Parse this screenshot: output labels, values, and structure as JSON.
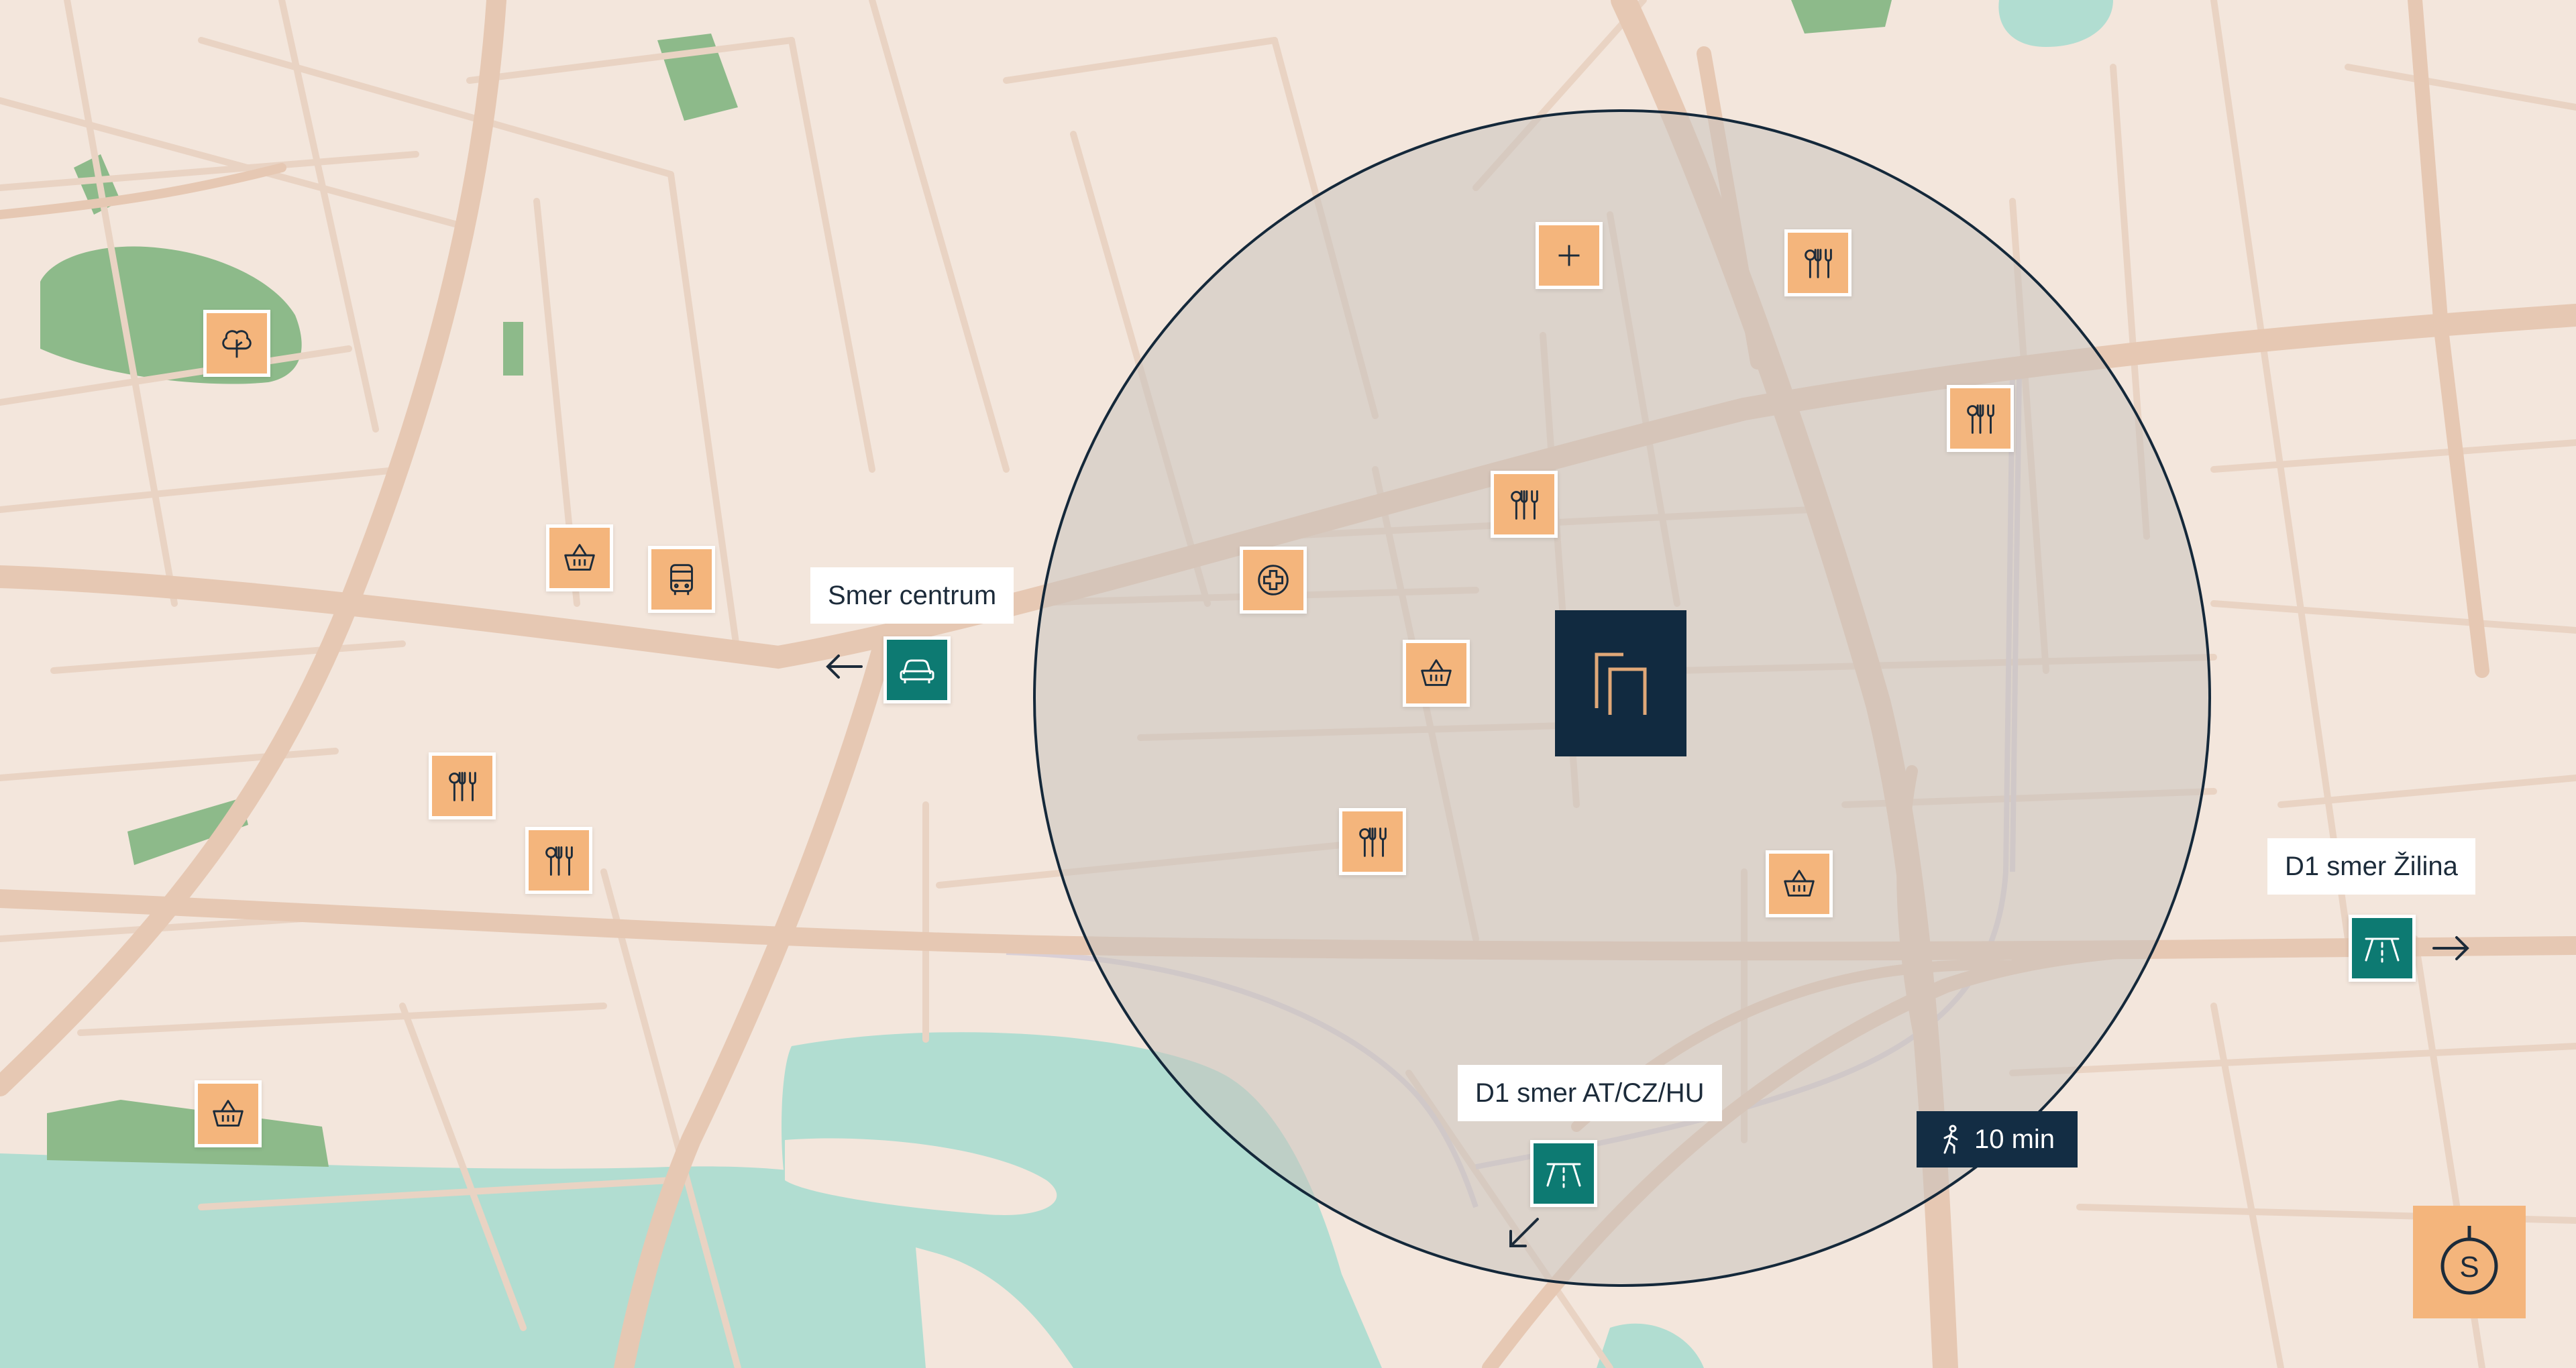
{
  "map": {
    "colors": {
      "land": "#f3e6dc",
      "road": "#e6c8b3",
      "street": "#e9d3c3",
      "water": "#b1ddd1",
      "park": "#8dba8a",
      "poi": "#f4b57c",
      "route": "#0d7a72",
      "project": "#112a40",
      "project_logo": "#e0a878",
      "radius_fill": "#c9c2bd",
      "radius_stroke": "#14283a"
    },
    "pois": [
      {
        "type": "park",
        "icon": "tree-icon"
      },
      {
        "type": "shop",
        "icon": "basket-icon"
      },
      {
        "type": "bus",
        "icon": "bus-icon"
      },
      {
        "type": "restaurant",
        "icon": "fork-knife-icon"
      },
      {
        "type": "restaurant",
        "icon": "fork-knife-icon"
      },
      {
        "type": "shop",
        "icon": "basket-icon"
      },
      {
        "type": "pharmacy",
        "icon": "plus-icon"
      },
      {
        "type": "restaurant",
        "icon": "fork-knife-icon"
      },
      {
        "type": "restaurant",
        "icon": "fork-knife-icon"
      },
      {
        "type": "restaurant",
        "icon": "fork-knife-icon"
      },
      {
        "type": "hospital",
        "icon": "medical-cross-icon"
      },
      {
        "type": "shop",
        "icon": "basket-icon"
      },
      {
        "type": "restaurant",
        "icon": "fork-knife-icon"
      },
      {
        "type": "shop",
        "icon": "basket-icon"
      }
    ],
    "routes": {
      "city_center": {
        "label": "Smer centrum",
        "icon": "car-icon",
        "direction": "west"
      },
      "d1_zilina": {
        "label": "D1 smer Žilina",
        "icon": "highway-icon",
        "direction": "east"
      },
      "d1_south": {
        "label": "D1 smer AT/CZ/HU",
        "icon": "highway-icon",
        "direction": "south-west"
      }
    },
    "walking_radius": {
      "label": "10 min",
      "icon": "pedestrian-icon"
    },
    "project_marker": {
      "icon": "project-logo-icon"
    },
    "brand": {
      "icon": "compass-s-icon",
      "letter": "S"
    }
  }
}
